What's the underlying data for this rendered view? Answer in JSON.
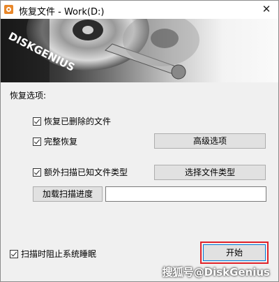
{
  "window": {
    "title": "恢复文件 - Work(D:)",
    "close_glyph": "✕"
  },
  "banner": {
    "logo_text": "DISKGENIUS"
  },
  "options": {
    "section_label": "恢复选项:",
    "recover_deleted": {
      "label": "恢复已删除的文件",
      "checked": true
    },
    "full_recover": {
      "label": "完整恢复",
      "checked": true
    },
    "extra_scan": {
      "label": "额外扫描已知文件类型",
      "checked": true
    },
    "advanced_button": "高级选项",
    "select_types_button": "选择文件类型",
    "load_progress_button": "加载扫描进度",
    "load_progress_value": ""
  },
  "footer": {
    "prevent_sleep": {
      "label": "扫描时阻止系统睡眠",
      "checked": true
    },
    "start_button": "开始"
  },
  "watermark": "搜狐号@DiskGenius",
  "colors": {
    "highlight": "#e0232a",
    "focus_border": "#0078d7",
    "icon": "#e8872a"
  }
}
